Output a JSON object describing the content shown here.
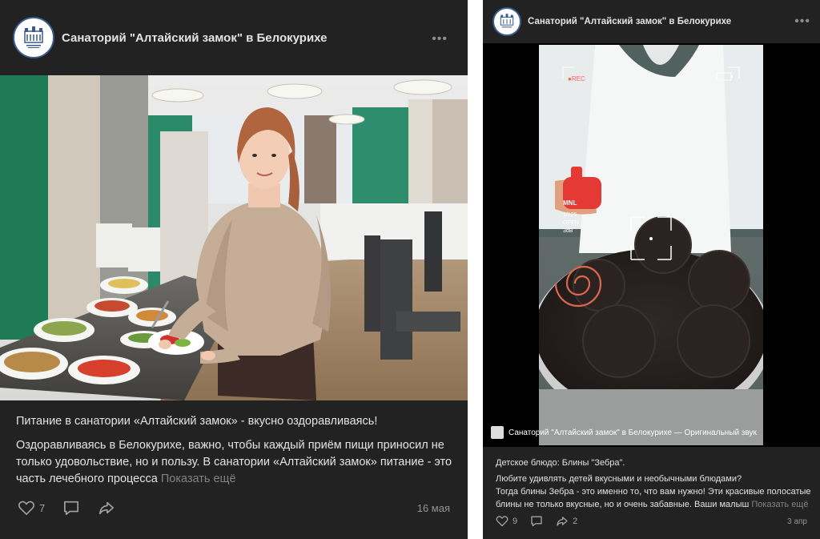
{
  "posts": [
    {
      "group_name": "Санаторий \"Алтайский замок\" в Белокурихе",
      "more_label": "•••",
      "title": "Питание в санатории «Алтайский замок» - вкусно оздоравливаясь!",
      "text": "Оздоравливаясь в Белокурихе, важно, чтобы каждый приём пищи приносил не только удовольствие, но и пользу. В санатории «Алтайский замок» питание - это часть лечебного процесса",
      "show_more": "Показать ещё",
      "likes": "7",
      "date": "16 мая",
      "icons": {
        "like": "heart-icon",
        "comment": "comment-icon",
        "share": "share-icon"
      }
    },
    {
      "group_name": "Санаторий \"Алтайский замок\" в Белокурихе",
      "more_label": "•••",
      "video_overlay": {
        "rec": "●REC",
        "brand": "MNL",
        "exposure": "1/125",
        "aperture": "OPEN",
        "gain": "3dB"
      },
      "video_caption": "Санаторий \"Алтайский замок\" в Белокурихе — Оригинальный звук",
      "title": "Детское блюдо: Блины \"Зебра\".",
      "text_line1": "Любите удивлять детей вкусными и необычными блюдами?",
      "text": "Тогда блины Зебра - это именно то, что вам нужно! Эти красивые полосатые блины не только вкусные, но и очень забавные. Ваши малыш",
      "show_more": "Показать ещё",
      "likes": "9",
      "shares": "2",
      "date": "3 апр",
      "icons": {
        "like": "heart-icon",
        "comment": "comment-icon",
        "share": "share-icon"
      }
    }
  ],
  "colors": {
    "card_bg": "#222222",
    "text": "#e1e3e6",
    "muted": "#828282",
    "logo_ring": "#3a5b8c"
  }
}
